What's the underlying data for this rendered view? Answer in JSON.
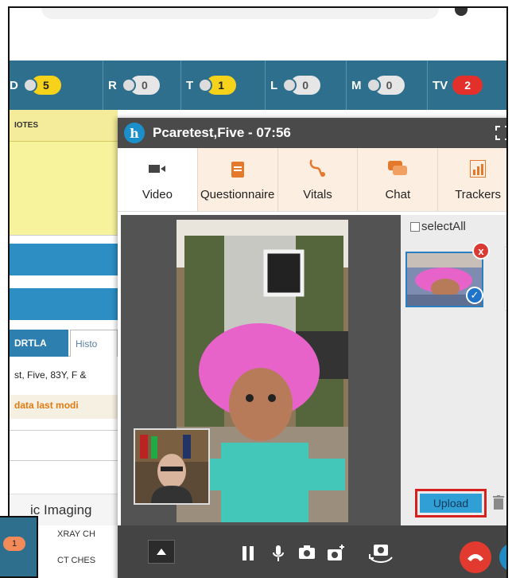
{
  "counter_bar": {
    "items": [
      {
        "letter": "D",
        "value": "5",
        "style": "yellow"
      },
      {
        "letter": "R",
        "value": "0",
        "style": "gray"
      },
      {
        "letter": "T",
        "value": "1",
        "style": "yellow"
      },
      {
        "letter": "L",
        "value": "0",
        "style": "gray"
      },
      {
        "letter": "M",
        "value": "0",
        "style": "gray"
      },
      {
        "letter": "TV",
        "value": "2",
        "style": "red"
      }
    ]
  },
  "background_app": {
    "notes_header": "IOTES",
    "tab_active": "DRTLA",
    "tab_inactive": "Histo",
    "patient_line": "st, Five, 83Y, F &",
    "data_notice": "data last modi",
    "section_title": "ic Imaging",
    "rows": [
      "XRAY CH",
      "CT CHES"
    ],
    "inset_badge": "1"
  },
  "popup": {
    "logo_letter": "h",
    "title": "Pcaretest,Five - 07:56",
    "tabs": [
      {
        "label": "Video",
        "icon": "video-camera-icon",
        "active": true
      },
      {
        "label": "Questionnaire",
        "icon": "clipboard-icon",
        "active": false
      },
      {
        "label": "Vitals",
        "icon": "stethoscope-icon",
        "active": false
      },
      {
        "label": "Chat",
        "icon": "chat-bubbles-icon",
        "active": false
      },
      {
        "label": "Trackers",
        "icon": "chart-tracker-icon",
        "active": false
      }
    ],
    "side_panel": {
      "select_all_label": "selectAll",
      "upload_label": "Upload"
    }
  },
  "colors": {
    "counter_bar": "#2e6f8e",
    "popup_header": "#4a4a4a",
    "tab_strip": "#fdeee2",
    "icon_orange": "#e5792b",
    "hangup_red": "#e23a2f",
    "upload_border": "#d6201e",
    "upload_blue": "#2f9fd6"
  }
}
